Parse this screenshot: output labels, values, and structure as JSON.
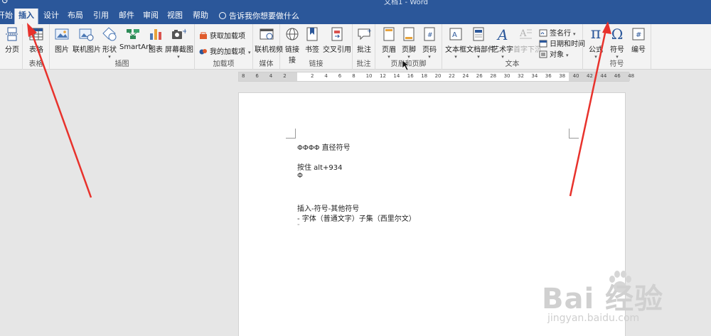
{
  "titlebar": {
    "text": "文档1 - Word",
    "quick_access": "↺"
  },
  "tabs": [
    {
      "label": "开始"
    },
    {
      "label": "插入"
    },
    {
      "label": "设计"
    },
    {
      "label": "布局"
    },
    {
      "label": "引用"
    },
    {
      "label": "邮件"
    },
    {
      "label": "审阅"
    },
    {
      "label": "视图"
    },
    {
      "label": "帮助"
    }
  ],
  "active_tab": "插入",
  "tellme": "告诉我你想要做什么",
  "ribbon": {
    "pages": {
      "page_break": "分页"
    },
    "table": {
      "table": "表格",
      "group": "表格"
    },
    "illustrations": {
      "picture": "图片",
      "online_picture": "联机图片",
      "shapes": "形状",
      "smartart": "SmartArt",
      "chart": "图表",
      "screenshot": "屏幕截图",
      "group": "插图"
    },
    "addins": {
      "get": "获取加载项",
      "my": "我的加载项",
      "group": "加载项"
    },
    "media": {
      "video": "联机视频",
      "group": "媒体"
    },
    "links": {
      "link": "链接",
      "link2": "接",
      "bookmark": "书签",
      "crossref": "交叉引用",
      "group": "链接"
    },
    "comments": {
      "comment": "批注",
      "group": "批注"
    },
    "header_footer": {
      "header": "页眉",
      "footer": "页脚",
      "page_number": "页码",
      "group": "页眉和页脚"
    },
    "text": {
      "textbox": "文本框",
      "quickparts": "文档部件",
      "wordart": "艺术字",
      "dropcap": "首字下沉",
      "signature": "签名行",
      "datetime": "日期和时间",
      "object": "对象",
      "group": "文本"
    },
    "symbols": {
      "equation": "公式",
      "symbol": "符号",
      "number": "编号",
      "group": "符号",
      "equation_glyph": "π",
      "symbol_glyph": "Ω",
      "number_glyph": "#"
    }
  },
  "ruler_numbers": [
    "8",
    "6",
    "4",
    "2",
    "",
    "2",
    "4",
    "6",
    "8",
    "10",
    "12",
    "14",
    "16",
    "18",
    "20",
    "22",
    "24",
    "26",
    "28",
    "30",
    "32",
    "34",
    "36",
    "38",
    "40",
    "42",
    "44",
    "46",
    "48"
  ],
  "document": {
    "lines": [
      "ΦΦΦΦ  直径符号",
      "按住 alt+934",
      "Φ",
      "插入-符号-其他符号",
      "-  字体（普通文字）子集（西里尔文）"
    ],
    "cursor_mark": "-"
  },
  "watermark": {
    "brand": "Bai  经验",
    "url": "jingyan.baidu.com"
  },
  "colors": {
    "word_blue": "#2b579a",
    "ribbon_bg": "#f3f3f3",
    "arrow_red": "#e8322c",
    "canvas": "#e6e6e6"
  }
}
